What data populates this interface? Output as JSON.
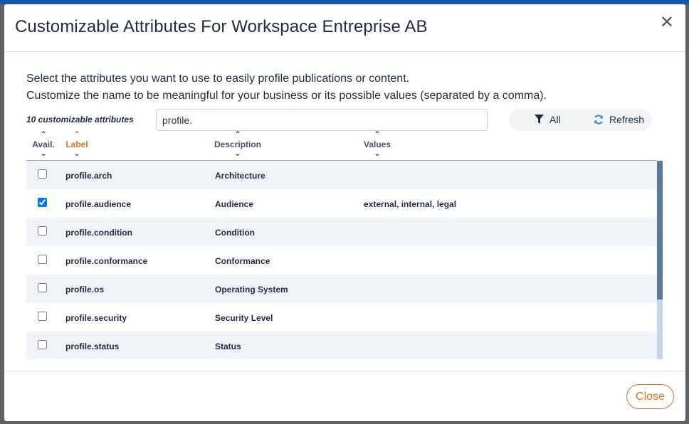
{
  "dialog": {
    "title": "Customizable Attributes For Workspace Entreprise AB",
    "intro_line1": "Select the attributes you want to use to easily profile publications or content.",
    "intro_line2": "Customize the name to be meaningful for your business or its possible values (separated by a comma).",
    "close_label": "Close"
  },
  "toolbar": {
    "count_text": "10 customizable attributes",
    "filter_value": "profile.",
    "all_label": "All",
    "refresh_label": "Refresh"
  },
  "columns": {
    "avail": "Avail.",
    "label": "Label",
    "description": "Description",
    "values": "Values"
  },
  "rows": [
    {
      "checked": false,
      "label": "profile.arch",
      "description": "Architecture",
      "values": ""
    },
    {
      "checked": true,
      "label": "profile.audience",
      "description": "Audience",
      "values": "external, internal, legal"
    },
    {
      "checked": false,
      "label": "profile.condition",
      "description": "Condition",
      "values": ""
    },
    {
      "checked": false,
      "label": "profile.conformance",
      "description": "Conformance",
      "values": ""
    },
    {
      "checked": false,
      "label": "profile.os",
      "description": "Operating System",
      "values": ""
    },
    {
      "checked": false,
      "label": "profile.security",
      "description": "Security Level",
      "values": ""
    },
    {
      "checked": false,
      "label": "profile.status",
      "description": "Status",
      "values": ""
    }
  ],
  "colors": {
    "accent": "#e0701e",
    "text": "#1f2a44",
    "row_alt": "#f0f4f8",
    "scroll_thumb": "#5a7897"
  }
}
